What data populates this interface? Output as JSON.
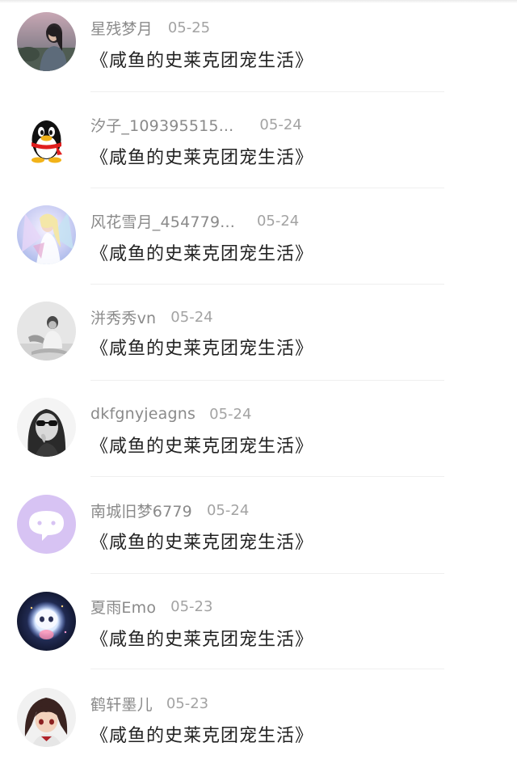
{
  "comments": [
    {
      "user": "星残梦月",
      "date": "05-25",
      "text": "《咸鱼的史莱克团宠生活》",
      "avatar_icon": "woman-photo-avatar"
    },
    {
      "user": "汐子_109395515...",
      "date": "05-24",
      "text": "《咸鱼的史莱克团宠生活》",
      "avatar_icon": "qq-penguin-avatar"
    },
    {
      "user": "风花雪月_454779...",
      "date": "05-24",
      "text": "《咸鱼的史莱克团宠生活》",
      "avatar_icon": "anime-girl-avatar"
    },
    {
      "user": "洴秀秀vn",
      "date": "05-24",
      "text": "《咸鱼的史莱克团宠生活》",
      "avatar_icon": "gray-portrait-avatar"
    },
    {
      "user": "dkfgnyjeagns",
      "date": "05-24",
      "text": "《咸鱼的史莱克团宠生活》",
      "avatar_icon": "sunglasses-portrait-avatar"
    },
    {
      "user": "南城旧梦6779",
      "date": "05-24",
      "text": "《咸鱼的史莱克团宠生活》",
      "avatar_icon": "chat-bubble-avatar"
    },
    {
      "user": "夏雨Emo",
      "date": "05-23",
      "text": "《咸鱼的史莱克团宠生活》",
      "avatar_icon": "glowing-robot-avatar"
    },
    {
      "user": "鹤轩墨儿",
      "date": "05-23",
      "text": "《咸鱼的史莱克团宠生活》",
      "avatar_icon": "anime-boy-avatar"
    }
  ],
  "colors": {
    "username": "#8a8a8a",
    "date": "#a3a3a3",
    "text": "#222222",
    "separator": "#efefef",
    "chat_avatar_bg": "#d7c3f3"
  }
}
